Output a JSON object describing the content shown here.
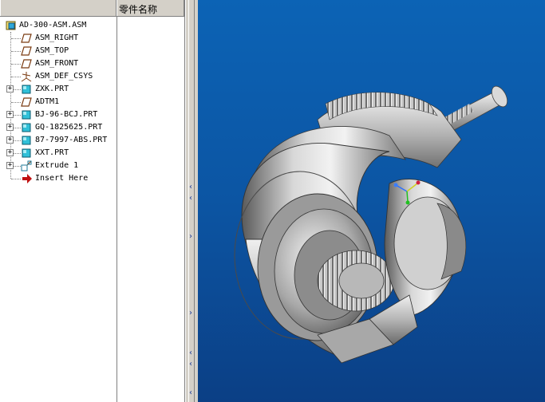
{
  "model_tree": {
    "column_header": "零件名称",
    "items": [
      {
        "label": "AD-300-ASM.ASM",
        "icon": "assembly-icon",
        "expandable": false
      },
      {
        "label": "ASM_RIGHT",
        "icon": "datum-plane-icon",
        "expandable": false
      },
      {
        "label": "ASM_TOP",
        "icon": "datum-plane-icon",
        "expandable": false
      },
      {
        "label": "ASM_FRONT",
        "icon": "datum-plane-icon",
        "expandable": false
      },
      {
        "label": "ASM_DEF_CSYS",
        "icon": "coordinate-system-icon",
        "expandable": false
      },
      {
        "label": "ZXK.PRT",
        "icon": "part-icon",
        "expandable": true
      },
      {
        "label": "ADTM1",
        "icon": "datum-plane-icon",
        "expandable": false
      },
      {
        "label": "BJ-96-BCJ.PRT",
        "icon": "part-icon",
        "expandable": true
      },
      {
        "label": "GQ-1825625.PRT",
        "icon": "part-icon",
        "expandable": true
      },
      {
        "label": "87-7997-ABS.PRT",
        "icon": "part-icon",
        "expandable": true
      },
      {
        "label": "XXT.PRT",
        "icon": "part-icon",
        "expandable": true
      },
      {
        "label": "Extrude 1",
        "icon": "extrude-icon",
        "expandable": true
      },
      {
        "label": "Insert Here",
        "icon": "insert-arrow-icon",
        "expandable": false
      }
    ]
  },
  "viewport": {
    "content": "3d-model-render",
    "background_top": "#0c63b5",
    "background_bottom": "#0b3f85"
  }
}
